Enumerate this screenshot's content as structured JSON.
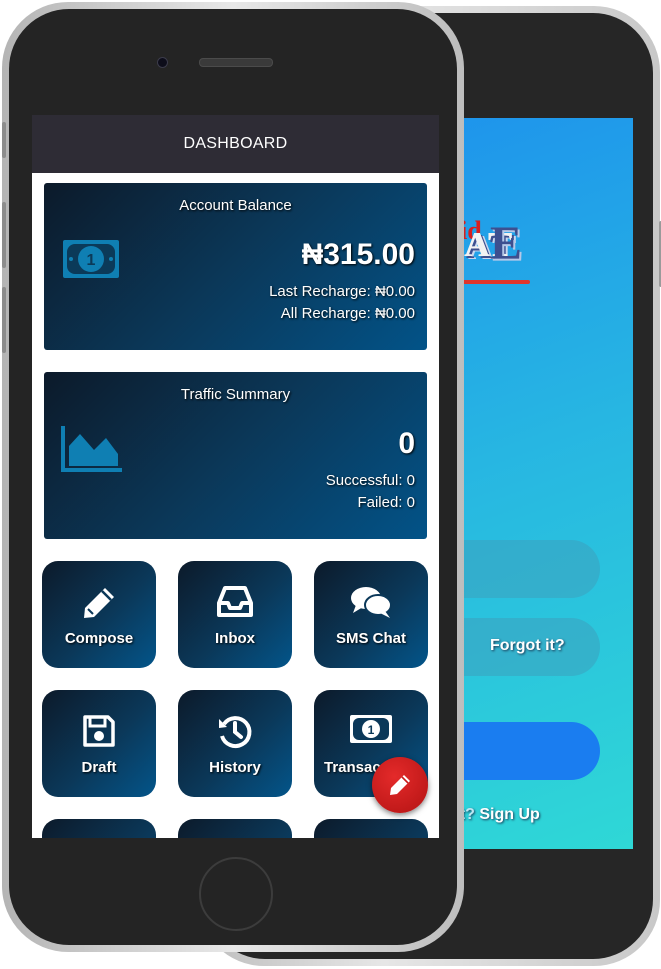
{
  "front": {
    "header": {
      "title": "DASHBOARD"
    },
    "balance_card": {
      "title": "Account Balance",
      "amount": "₦315.00",
      "last_recharge": "Last Recharge: ₦0.00",
      "all_recharge": "All Recharge: ₦0.00",
      "icon": "money-bill-icon"
    },
    "traffic_card": {
      "title": "Traffic Summary",
      "total": "0",
      "successful": "Successful: 0",
      "failed": "Failed: 0",
      "icon": "area-chart-icon"
    },
    "tiles": [
      {
        "label": "Compose",
        "icon": "pencil-icon"
      },
      {
        "label": "Inbox",
        "icon": "inbox-tray-icon"
      },
      {
        "label": "SMS Chat",
        "icon": "chat-bubbles-icon"
      },
      {
        "label": "Draft",
        "icon": "floppy-disk-icon"
      },
      {
        "label": "History",
        "icon": "history-clock-icon"
      },
      {
        "label": "Transac",
        "icon": "money-bill-icon"
      }
    ],
    "fab": {
      "icon": "pencil-icon"
    }
  },
  "back": {
    "logo": {
      "part1": "id",
      "part2": "E"
    },
    "forgot_label": "Forgot it?",
    "signup_prefix": "nt? ",
    "signup_link": "Sign Up"
  },
  "colors": {
    "header_bg": "#2e2c35",
    "card_gradient_start": "#0c1a2a",
    "card_gradient_end": "#025388",
    "fab_red": "#c81a1a",
    "login_gradient_start": "#1e94ec",
    "login_gradient_end": "#2fd8d6"
  }
}
